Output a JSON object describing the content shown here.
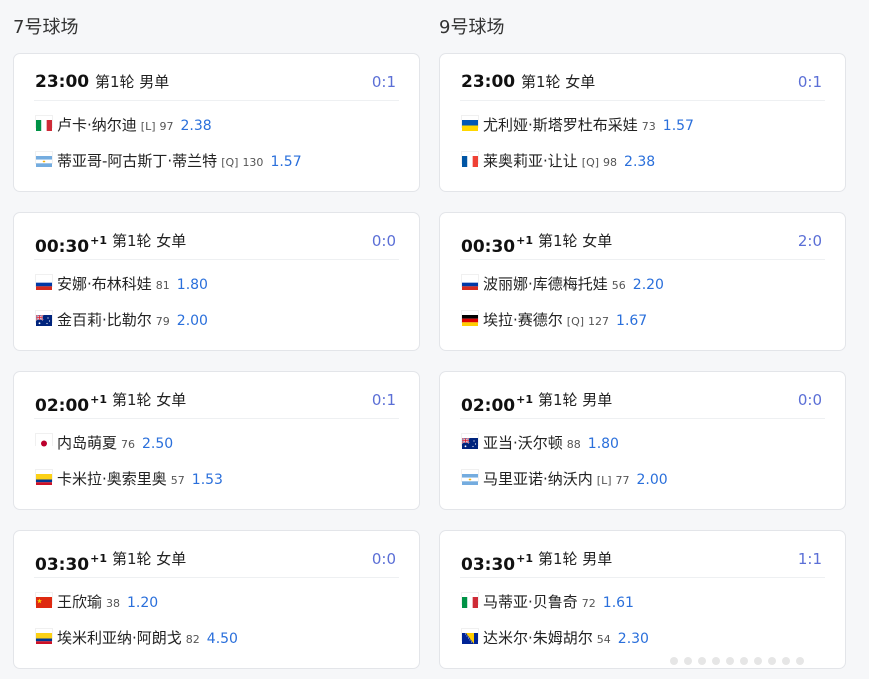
{
  "courts": [
    {
      "title": "7号球场",
      "matches": [
        {
          "time": "23:00",
          "plus": "",
          "round": "第1轮 男单",
          "score": "0:1",
          "p1": {
            "flag": "it",
            "name": "卢卡·纳尔迪",
            "tag": "[L]",
            "rank": "97",
            "odds": "2.38"
          },
          "p2": {
            "flag": "ar",
            "name": "蒂亚哥-阿古斯丁·蒂兰特",
            "tag": "[Q]",
            "rank": "130",
            "odds": "1.57"
          }
        },
        {
          "time": "00:30",
          "plus": "+1",
          "round": "第1轮 女单",
          "score": "0:0",
          "p1": {
            "flag": "ru",
            "name": "安娜·布林科娃",
            "tag": "",
            "rank": "81",
            "odds": "1.80"
          },
          "p2": {
            "flag": "au",
            "name": "金百莉·比勒尔",
            "tag": "",
            "rank": "79",
            "odds": "2.00"
          }
        },
        {
          "time": "02:00",
          "plus": "+1",
          "round": "第1轮 女单",
          "score": "0:1",
          "p1": {
            "flag": "jp",
            "name": "内岛萌夏",
            "tag": "",
            "rank": "76",
            "odds": "2.50"
          },
          "p2": {
            "flag": "co",
            "name": "卡米拉·奥索里奥",
            "tag": "",
            "rank": "57",
            "odds": "1.53"
          }
        },
        {
          "time": "03:30",
          "plus": "+1",
          "round": "第1轮 女单",
          "score": "0:0",
          "p1": {
            "flag": "cn",
            "name": "王欣瑜",
            "tag": "",
            "rank": "38",
            "odds": "1.20"
          },
          "p2": {
            "flag": "co",
            "name": "埃米利亚纳·阿朗戈",
            "tag": "",
            "rank": "82",
            "odds": "4.50"
          }
        }
      ]
    },
    {
      "title": "9号球场",
      "matches": [
        {
          "time": "23:00",
          "plus": "",
          "round": "第1轮 女单",
          "score": "0:1",
          "p1": {
            "flag": "ua",
            "name": "尤利娅·斯塔罗杜布采娃",
            "tag": "",
            "rank": "73",
            "odds": "1.57"
          },
          "p2": {
            "flag": "fr",
            "name": "莱奥莉亚·让让",
            "tag": "[Q]",
            "rank": "98",
            "odds": "2.38"
          }
        },
        {
          "time": "00:30",
          "plus": "+1",
          "round": "第1轮 女单",
          "score": "2:0",
          "p1": {
            "flag": "ru",
            "name": "波丽娜·库德梅托娃",
            "tag": "",
            "rank": "56",
            "odds": "2.20"
          },
          "p2": {
            "flag": "de",
            "name": "埃拉·赛德尔",
            "tag": "[Q]",
            "rank": "127",
            "odds": "1.67"
          }
        },
        {
          "time": "02:00",
          "plus": "+1",
          "round": "第1轮 男单",
          "score": "0:0",
          "p1": {
            "flag": "au",
            "name": "亚当·沃尔顿",
            "tag": "",
            "rank": "88",
            "odds": "1.80"
          },
          "p2": {
            "flag": "ar",
            "name": "马里亚诺·纳沃内",
            "tag": "[L]",
            "rank": "77",
            "odds": "2.00"
          }
        },
        {
          "time": "03:30",
          "plus": "+1",
          "round": "第1轮 男单",
          "score": "1:1",
          "p1": {
            "flag": "it",
            "name": "马蒂亚·贝鲁奇",
            "tag": "",
            "rank": "72",
            "odds": "1.61"
          },
          "p2": {
            "flag": "ba",
            "name": "达米尔·朱姆胡尔",
            "tag": "",
            "rank": "54",
            "odds": "2.30"
          }
        }
      ]
    }
  ],
  "colors": {
    "score": "#5b6fd6",
    "odds": "#2a6fdb"
  }
}
